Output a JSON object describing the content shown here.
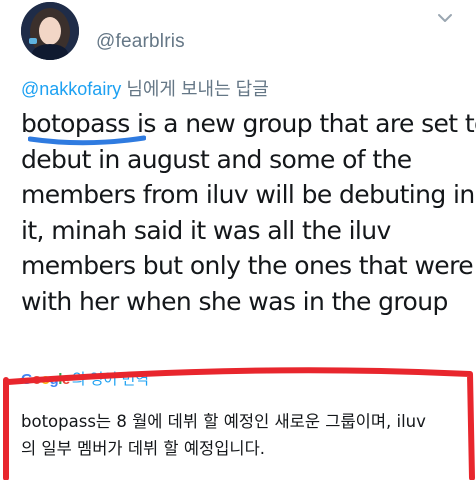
{
  "tweet": {
    "handle": "@fearblris",
    "reply_to": {
      "mention": "@nakkofairy",
      "suffix": " 님에게 보내는 답글"
    },
    "body_lines": [
      "botopass is a new group that are set to",
      "debut in august and some of the",
      "members from iluv will be debuting in",
      "it, minah said it was all the iluv",
      "members but only the ones that were",
      "with her when she was in the group"
    ],
    "translate": {
      "logo": [
        "G",
        "o",
        "o",
        "g",
        "l",
        "e"
      ],
      "label": "의 영어 번역"
    },
    "translation_lines": [
      "botopass는 8 월에 데뷔 할 예정인 새로운 그룹이며, iluv",
      "의 일부 멤버가 데뷔 할 예정입니다."
    ]
  },
  "colors": {
    "link": "#1da1f2",
    "muted": "#657786",
    "text": "#14171a",
    "annotation_red": "#e8262d",
    "annotation_blue": "#2f7be0"
  },
  "icons": {
    "avatar": "profile-photo",
    "more": "chevron-down-icon"
  }
}
